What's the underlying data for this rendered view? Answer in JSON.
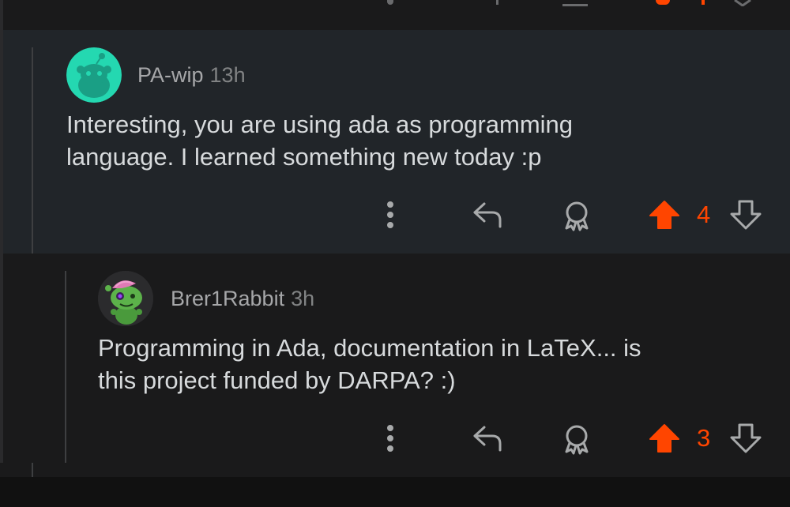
{
  "colors": {
    "upvote": "#ff4500",
    "text": "#d7dadc",
    "muted": "#818384",
    "highlight_bg": "#212529"
  },
  "comments": [
    {
      "author": "PA-wip",
      "time": "13h",
      "avatar": "snoo-avatar-teal",
      "body_line1": "Interesting, you are using ada as programming",
      "body_line2": "language. I learned something new today :p",
      "score": "4",
      "upvoted": true
    },
    {
      "author": "Brer1Rabbit",
      "time": "3h",
      "avatar": "snoo-avatar-green",
      "body_line1": "Programming in Ada, documentation in LaTeX... is",
      "body_line2": "this project funded by DARPA? :)",
      "score": "3",
      "upvoted": true
    }
  ],
  "actions": {
    "more": "more-icon",
    "reply": "reply-icon",
    "award": "award-icon",
    "upvote": "upvote-icon",
    "downvote": "downvote-icon"
  }
}
